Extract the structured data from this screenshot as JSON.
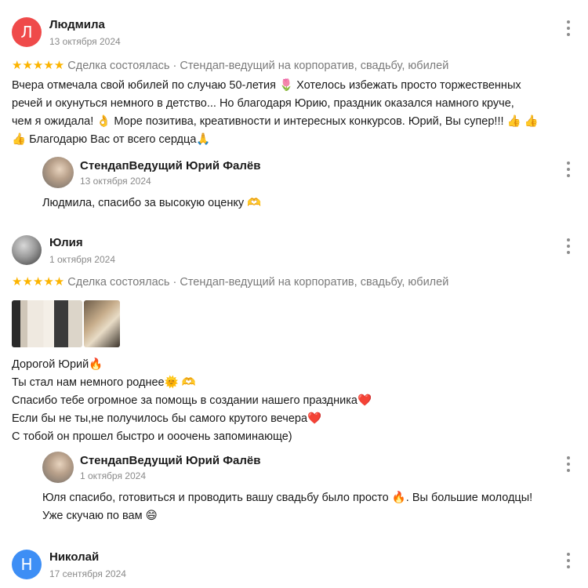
{
  "reviews": [
    {
      "initial": "Л",
      "avatar_color": "#ef4a4a",
      "name": "Людмила",
      "date": "13 октября 2024",
      "stars": "★★★★★",
      "deal": "Сделка состоялась · Стендап-ведущий на корпоратив, свадьбу, юбилей",
      "text_lines": [
        "Вчера отмечала свой юбилей по случаю 50-летия 🌷 Хотелось избежать просто торжественных",
        "речей и окунуться немного в детство... Но благодаря Юрию, праздник оказался намного круче,",
        "чем я ожидала! 👌 Море позитива, креативности и интересных конкурсов. Юрий, Вы супер!!! 👍 👍",
        "👍 Благодарю Вас от всего сердца🙏"
      ],
      "reply": {
        "name": "СтендапВедущий Юрий Фалёв",
        "date": "13 октября 2024",
        "text_lines": [
          "Людмила, спасибо за высокую оценку 🫶"
        ]
      }
    },
    {
      "name": "Юлия",
      "date": "1 октября 2024",
      "stars": "★★★★★",
      "deal": "Сделка состоялась · Стендап-ведущий на корпоратив, свадьбу, юбилей",
      "text_lines": [
        "Дорогой Юрий🔥",
        "Ты стал нам немного роднее🌞 🫶",
        "Спасибо тебе огромное за помощь в создании нашего праздника❤️",
        "Если бы не ты,не получилось бы самого крутого вечера❤️",
        "С тобой он прошел быстро и ооочень запоминающе)"
      ],
      "reply": {
        "name": "СтендапВедущий Юрий Фалёв",
        "date": "1 октября 2024",
        "text_lines": [
          "Юля спасибо, готовиться и проводить вашу свадьбу было просто 🔥. Вы большие молодцы!",
          "Уже скучаю по вам 😄"
        ]
      }
    },
    {
      "initial": "Н",
      "avatar_color": "#3d8ef5",
      "name": "Николай",
      "date": "17 сентября 2024"
    }
  ]
}
